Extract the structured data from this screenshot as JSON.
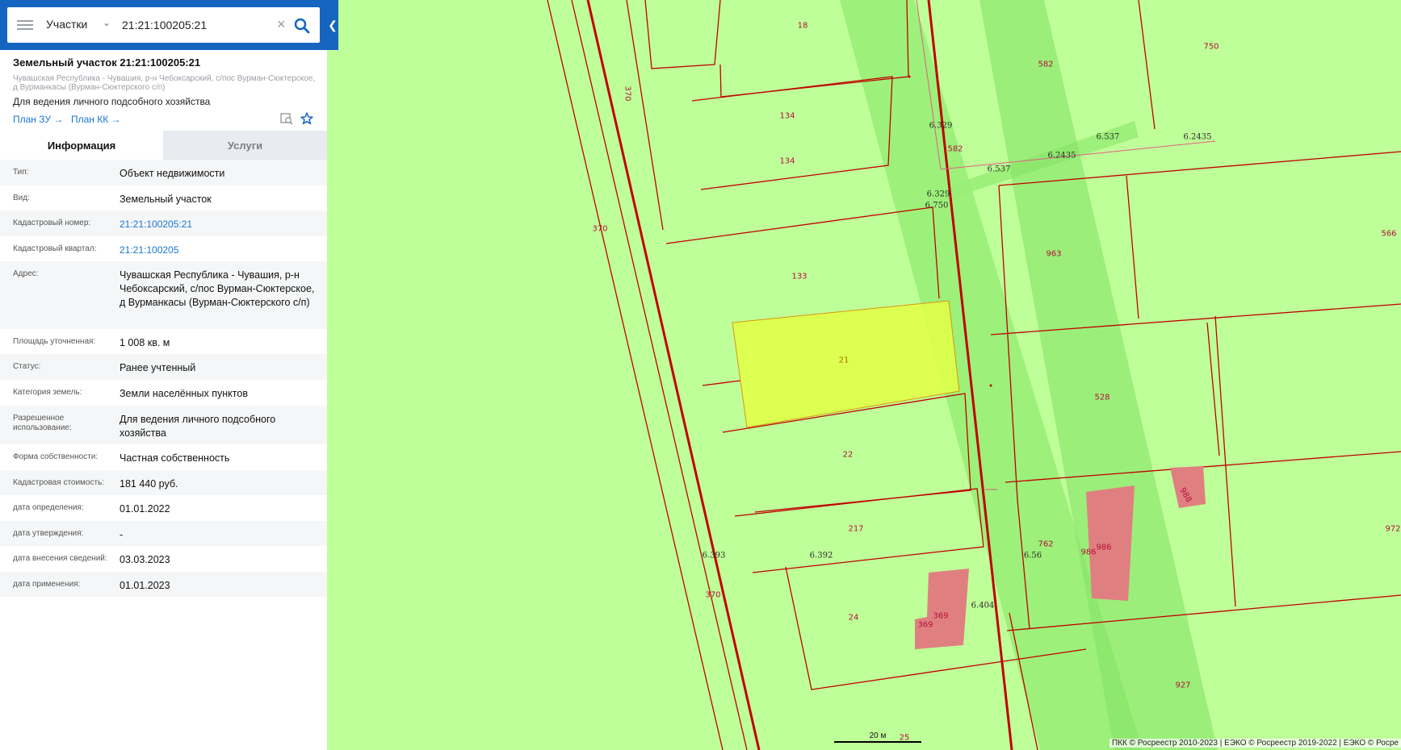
{
  "search": {
    "type_label": "Участки",
    "query": "21:21:100205:21"
  },
  "parcel": {
    "title": "Земельный участок 21:21:100205:21",
    "address_short": "Чувашская Республика - Чувашия, р-н Чебоксарский, с/пос Вурман-Сюктерское, д Вурманкасы (Вурман-Сюктерского с/п)",
    "use": "Для ведения личного подсобного хозяйства",
    "link_plan_zu": "План ЗУ →",
    "link_plan_kk": "План КК →"
  },
  "tabs": {
    "info": "Информация",
    "services": "Услуги"
  },
  "info_rows": [
    {
      "label": "Тип:",
      "value": "Объект недвижимости"
    },
    {
      "label": "Вид:",
      "value": "Земельный участок"
    },
    {
      "label": "Кадастровый номер:",
      "value": "21:21:100205:21"
    },
    {
      "label": "Кадастровый квартал:",
      "value": "21:21:100205"
    },
    {
      "label": "Адрес:",
      "value": "Чувашская Республика - Чувашия, р-н Чебоксарский, с/пос Вурман-Сюктерское, д Вурманкасы (Вурман-Сюктерского с/п)"
    },
    {
      "label": "Площадь уточненная:",
      "value": "1 008 кв. м"
    },
    {
      "label": "Статус:",
      "value": "Ранее учтенный"
    },
    {
      "label": "Категория земель:",
      "value": "Земли населённых пунктов"
    },
    {
      "label": "Разрешенное использование:",
      "value": "Для ведения личного подсобного хозяйства"
    },
    {
      "label": "Форма собственности:",
      "value": "Частная собственность"
    },
    {
      "label": "Кадастровая стоимость:",
      "value": "181 440 руб."
    },
    {
      "label": "дата определения:",
      "value": "01.01.2022"
    },
    {
      "label": "дата утверждения:",
      "value": "-"
    },
    {
      "label": "дата внесения сведений:",
      "value": "03.03.2023"
    },
    {
      "label": "дата применения:",
      "value": "01.01.2023"
    }
  ],
  "map": {
    "parcel_labels": [
      "18",
      "582",
      "750",
      "370",
      "134",
      "134",
      "370",
      "133",
      "963",
      "566",
      "21",
      "528",
      "22",
      "217",
      "762",
      "986",
      "986",
      "988",
      "972",
      "370",
      "24",
      "369",
      "369",
      "927",
      "25",
      "582"
    ],
    "zone_labels": [
      "6.329",
      "6.537",
      "6.2435",
      "6.2435",
      "6.537",
      "6.329",
      "6.750",
      "6.393",
      "6.392",
      "6.56",
      "6.404"
    ],
    "scale": "20 м",
    "attribution": "ПКК © Росреестр 2010-2023 | ЕЭКО © Росреестр 2019-2022 | ЕЭКО © Росре"
  },
  "colors": {
    "accent": "#1565c0",
    "map_bg": "#bfff99",
    "selected_parcel": "#e0ff4a",
    "parcel_border": "#c00000",
    "building": "#e07f80"
  }
}
